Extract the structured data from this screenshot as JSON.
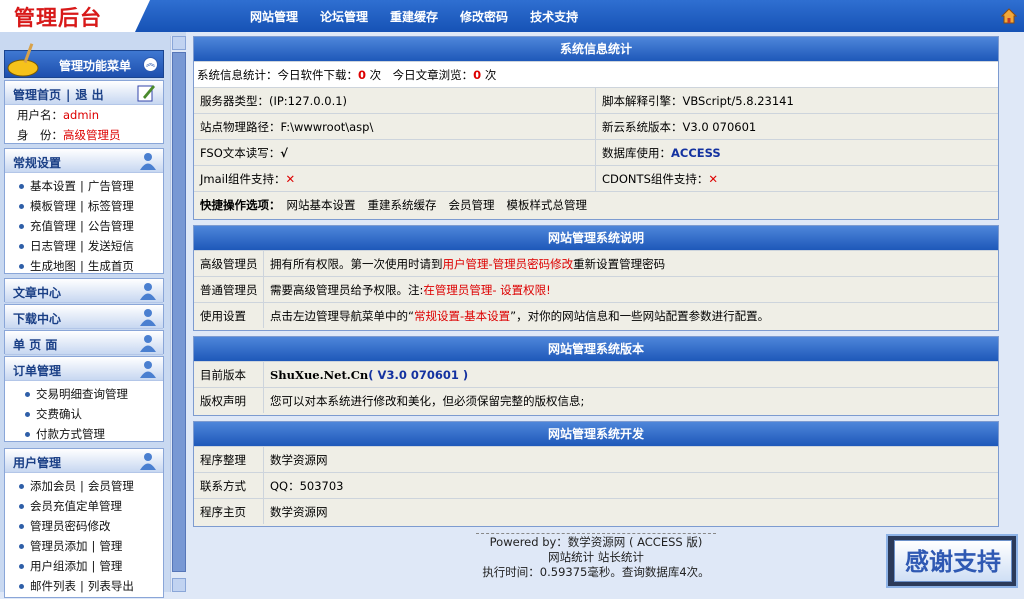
{
  "logo_text": "管理后台",
  "top_nav": [
    "网站管理",
    "论坛管理",
    "重建缓存",
    "修改密码",
    "技术支持"
  ],
  "menu_header": "管理功能菜单",
  "admin_panel": {
    "links": [
      "管理首页",
      "退 出"
    ],
    "user_label": "用户名：",
    "user_value": "admin",
    "role_label": "身　份：",
    "role_value": "高级管理员"
  },
  "sections": {
    "changgui": {
      "title": "常规设置",
      "rows": [
        [
          "基本设置",
          "广告管理"
        ],
        [
          "模板管理",
          "标签管理"
        ],
        [
          "充值管理",
          "公告管理"
        ],
        [
          "日志管理",
          "发送短信"
        ],
        [
          "生成地图",
          "生成首页"
        ]
      ]
    },
    "wenzhang": {
      "title": "文章中心"
    },
    "xiazai": {
      "title": "下载中心"
    },
    "danye": {
      "title": "单 页 面"
    },
    "dingdan": {
      "title": "订单管理",
      "rows": [
        [
          "交易明细查询管理"
        ],
        [
          "交费确认"
        ],
        [
          "付款方式管理"
        ]
      ]
    },
    "yonghu": {
      "title": "用户管理",
      "rows": [
        [
          "添加会员",
          "会员管理"
        ],
        [
          "会员充值定单管理"
        ],
        [
          "管理员密码修改"
        ],
        [
          "管理员添加",
          "管理"
        ],
        [
          "用户组添加",
          "管理"
        ],
        [
          "邮件列表",
          "列表导出"
        ]
      ]
    }
  },
  "stats": {
    "title": "系统信息统计",
    "line_prefix": "系统信息统计：今日软件下载：",
    "soft_count": "0",
    "unit1": " 次　今日文章浏览：",
    "article_count": "0",
    "unit2": " 次",
    "rows": [
      [
        "服务器类型：(IP:127.0.0.1)",
        "脚本解释引擎：VBScript/5.8.23141"
      ],
      [
        "站点物理路径：F:\\wwwroot\\asp\\",
        "新云系统版本：V3.0 070601"
      ]
    ],
    "fso_label": "FSO文本读写：",
    "fso_mark": "√",
    "db_label": "数据库使用：",
    "db_value": "ACCESS",
    "jmail_label": "Jmail组件支持：",
    "cdonts_label": "CDONTS组件支持：",
    "cross_mark": "✕",
    "quick_label": "快捷操作选项：",
    "quick_links": [
      "网站基本设置",
      "重建系统缓存",
      "会员管理",
      "模板样式总管理"
    ]
  },
  "desc": {
    "title": "网站管理系统说明",
    "r1_label": "高级管理员",
    "r1_a": "拥有所有权限。第一次使用时请到",
    "r1_link": "用户管理-管理员密码修改",
    "r1_b": "重新设置管理密码",
    "r2_label": "普通管理员",
    "r2_a": "需要高级管理员给予权限。注:",
    "r2_link": "在管理员管理- 设置权限!",
    "r3_label": "使用设置",
    "r3_a": "点击左边管理导航菜单中的“",
    "r3_link": "常规设置-基本设置",
    "r3_b": "”，对你的网站信息和一些网站配置参数进行配置。"
  },
  "version": {
    "title": "网站管理系统版本",
    "r1_label": "目前版本",
    "r1_a": "ShuXue.Net.Cn",
    "r1_b": "( V3.0 070601 )",
    "r2_label": "版权声明",
    "r2_value": "您可以对本系统进行修改和美化，但必须保留完整的版权信息;"
  },
  "dev": {
    "title": "网站管理系统开发",
    "rows": [
      [
        "程序整理",
        "数学资源网"
      ],
      [
        "联系方式",
        "QQ：503703"
      ],
      [
        "程序主页",
        "数学资源网"
      ]
    ]
  },
  "footer": {
    "line1": "Powered by：数学资源网 ( ACCESS 版)",
    "line2": "网站统计  站长统计",
    "line3": "执行时间：0.59375毫秒。查询数据库4次。"
  },
  "thanks_button": "感谢支持",
  "colors": {
    "accent": "#1e58b9",
    "link_red": "#dd0000",
    "version_blue": "#1432a0"
  }
}
